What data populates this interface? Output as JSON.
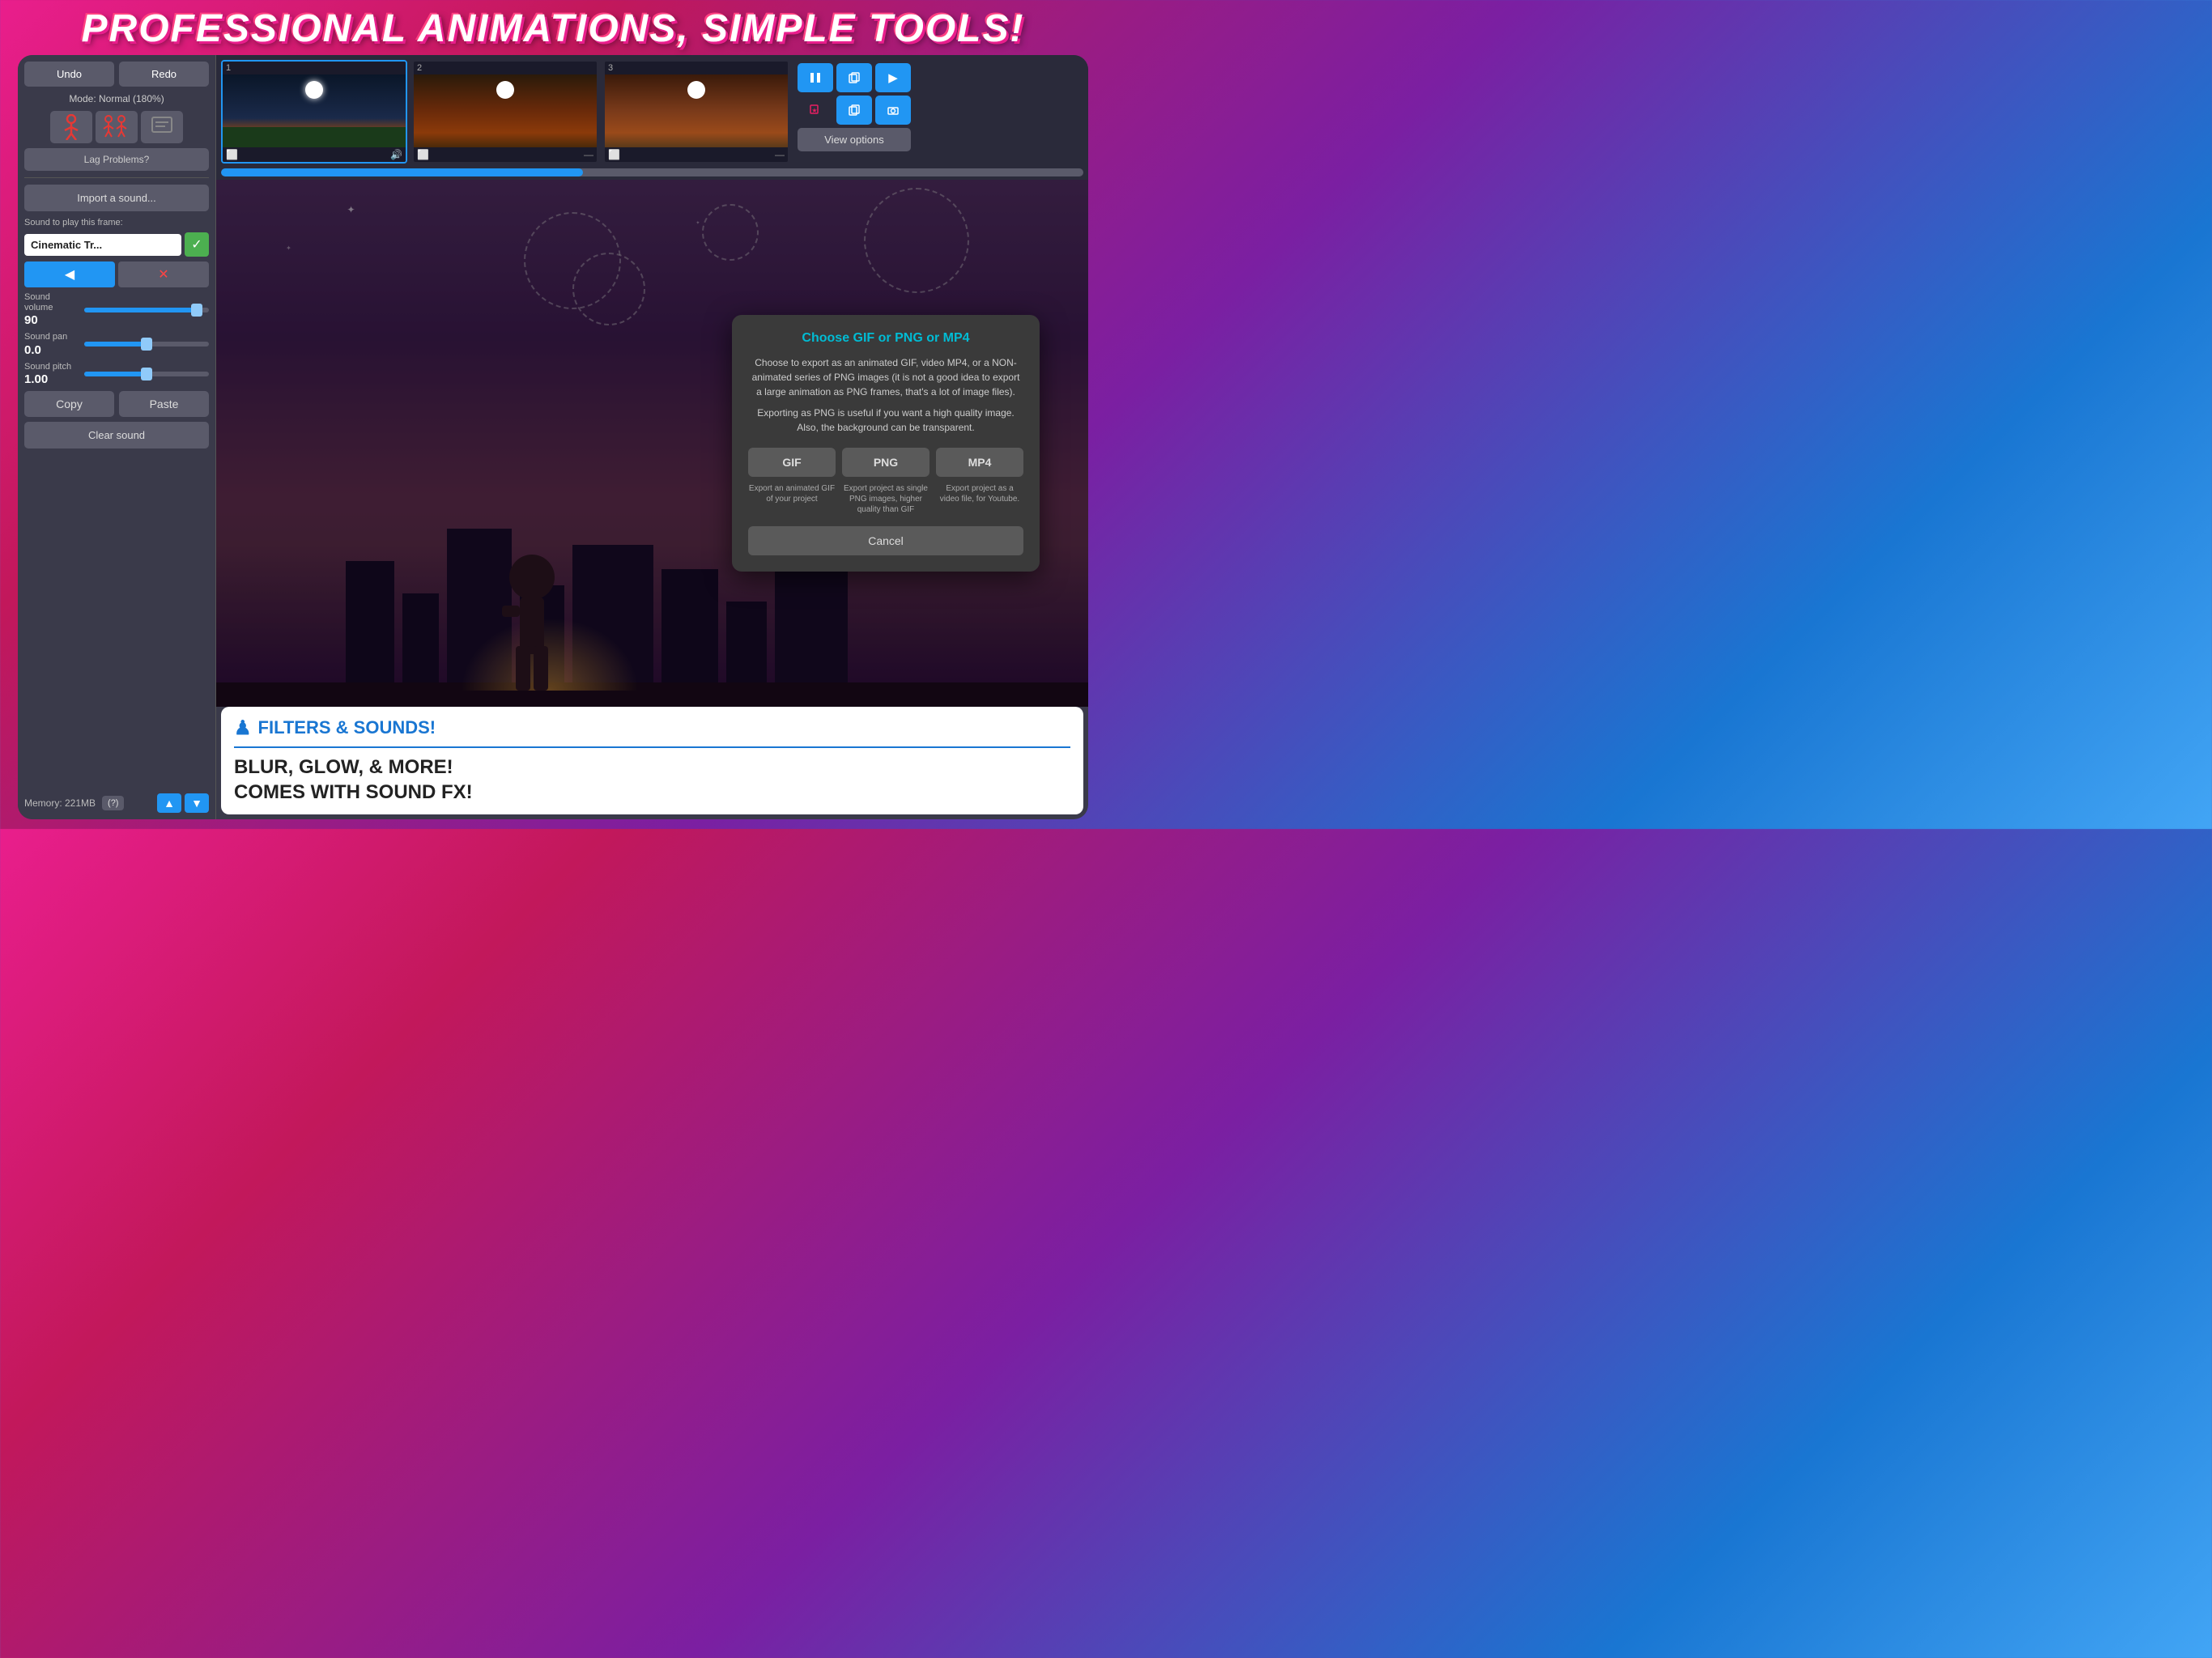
{
  "title": "PROFESSIONAL ANIMATIONS, SIMPLE TOOLS!",
  "header": {
    "undo": "Undo",
    "redo": "Redo",
    "mode": "Mode: Normal (180%)"
  },
  "sidebar": {
    "lag_problems": "Lag Problems?",
    "import_sound": "Import a sound...",
    "sound_frame_label": "Sound to play this frame:",
    "sound_name": "Cinematic Tr...",
    "sound_volume_label": "Sound\nvolume",
    "sound_volume_value": "90",
    "sound_pan_label": "Sound pan",
    "sound_pan_value": "0.0",
    "sound_pitch_label": "Sound pitch",
    "sound_pitch_value": "1.00",
    "copy": "Copy",
    "paste": "Paste",
    "clear_sound": "Clear sound",
    "memory": "Memory: 221MB",
    "help": "(?)"
  },
  "frames": [
    {
      "number": "1",
      "active": true
    },
    {
      "number": "2",
      "active": false
    },
    {
      "number": "3",
      "active": false
    }
  ],
  "view_options": "View options",
  "export_modal": {
    "title": "Choose GIF or PNG or MP4",
    "description": "Choose to export as an animated GIF, video MP4, or a NON-animated series of PNG images (it is not a good idea to export a large animation as PNG frames, that's a lot of image files).",
    "description2": "Exporting as PNG is useful if you want a high quality image. Also, the background can be transparent.",
    "gif_label": "GIF",
    "png_label": "PNG",
    "mp4_label": "MP4",
    "gif_desc": "Export an animated GIF of your project",
    "png_desc": "Export project as single PNG images, higher quality than GIF",
    "mp4_desc": "Export project as a video file, for Youtube.",
    "cancel": "Cancel"
  },
  "promo": {
    "icon": "♟",
    "title": "FILTERS & SOUNDS!",
    "divider": true,
    "text": "BLUR, GLOW, & MORE!\nCOMES WITH SOUND FX!"
  },
  "progress_percent": 42
}
